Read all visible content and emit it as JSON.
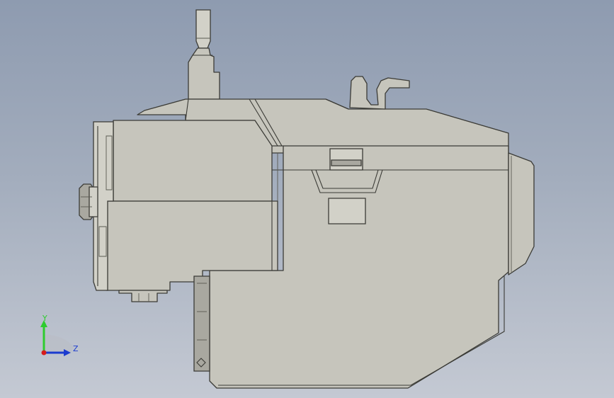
{
  "viewport": {
    "background_top": "#8e9bb0",
    "background_bottom": "#c4c9d3",
    "model_face_color": "#c6c5bc",
    "edge_color": "#3b3b36"
  },
  "triad": {
    "y_label": "Y",
    "z_label": "Z",
    "y_color": "#2ecc2e",
    "z_color": "#1c3ccf",
    "x_color": "#d61c1c"
  }
}
